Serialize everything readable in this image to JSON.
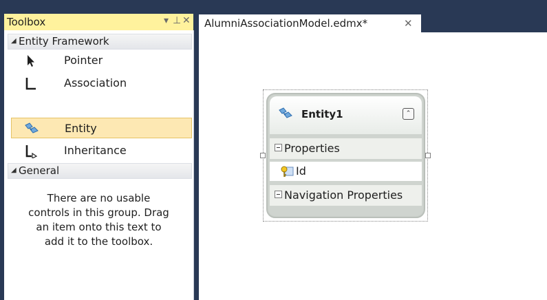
{
  "toolbox": {
    "title": "Toolbox",
    "dropdown_glyph": "▾",
    "pin_glyph": "⊥",
    "close_glyph": "✕",
    "groups": [
      {
        "label": "Entity Framework"
      },
      {
        "label": "General"
      }
    ],
    "items": [
      {
        "label": "Pointer",
        "icon": "pointer-icon"
      },
      {
        "label": "Association",
        "icon": "association-icon"
      },
      {
        "label": "Entity",
        "icon": "entity-icon",
        "selected": true
      },
      {
        "label": "Inheritance",
        "icon": "inheritance-icon"
      }
    ],
    "general_empty_text": [
      "There are no usable",
      "controls in this group. Drag",
      "an item onto this text to",
      "add it to the toolbox."
    ]
  },
  "document": {
    "tab_title": "AlumniAssociationModel.edmx*",
    "tab_close_glyph": "✕"
  },
  "entity": {
    "name": "Entity1",
    "collapse_glyph": "⌃",
    "sections": [
      {
        "label": "Properties"
      },
      {
        "label": "Navigation Properties"
      }
    ],
    "properties": [
      {
        "name": "Id",
        "icon": "key-property-icon"
      }
    ]
  },
  "colors": {
    "background": "#293955",
    "toolbox_header": "#fff29d",
    "selected_item": "#fde8b3"
  }
}
